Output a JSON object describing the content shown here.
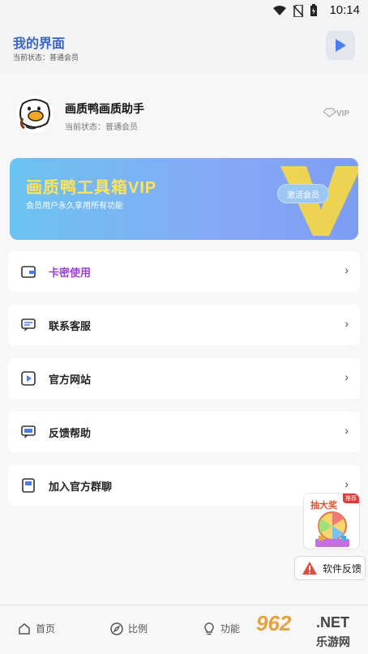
{
  "status_bar": {
    "time": "10:14"
  },
  "header": {
    "title": "我的界面",
    "subtitle": "当前状态：普通会员"
  },
  "profile": {
    "name": "画质鸭画质助手",
    "status": "当前状态：普通会员",
    "vip_label": "VIP"
  },
  "banner": {
    "title": "画质鸭工具箱VIP",
    "subtitle": "会员用户永久享用所有功能",
    "activate_label": "激活会员",
    "big_letter": "V"
  },
  "menu": [
    {
      "label": "卡密使用",
      "icon": "wallet-icon"
    },
    {
      "label": "联系客服",
      "icon": "chat-icon"
    },
    {
      "label": "官方网站",
      "icon": "play-square-icon"
    },
    {
      "label": "反馈帮助",
      "icon": "message-icon"
    },
    {
      "label": "加入官方群聊",
      "icon": "book-icon"
    }
  ],
  "chevron": "›",
  "floating": {
    "lottery_title": "抽大奖",
    "lottery_badge": "推荐",
    "feedback_label": "软件反馈"
  },
  "tabs": [
    {
      "label": "首页",
      "icon": "home-icon"
    },
    {
      "label": "比例",
      "icon": "compass-icon"
    },
    {
      "label": "功能",
      "icon": "bulb-icon"
    }
  ],
  "watermark": {
    "number": "962",
    "net": ".NET",
    "cn": "乐游网"
  },
  "colors": {
    "accent": "#3b63c9",
    "purple": "#9b3fd6",
    "banner_yellow": "#ffe35a"
  }
}
